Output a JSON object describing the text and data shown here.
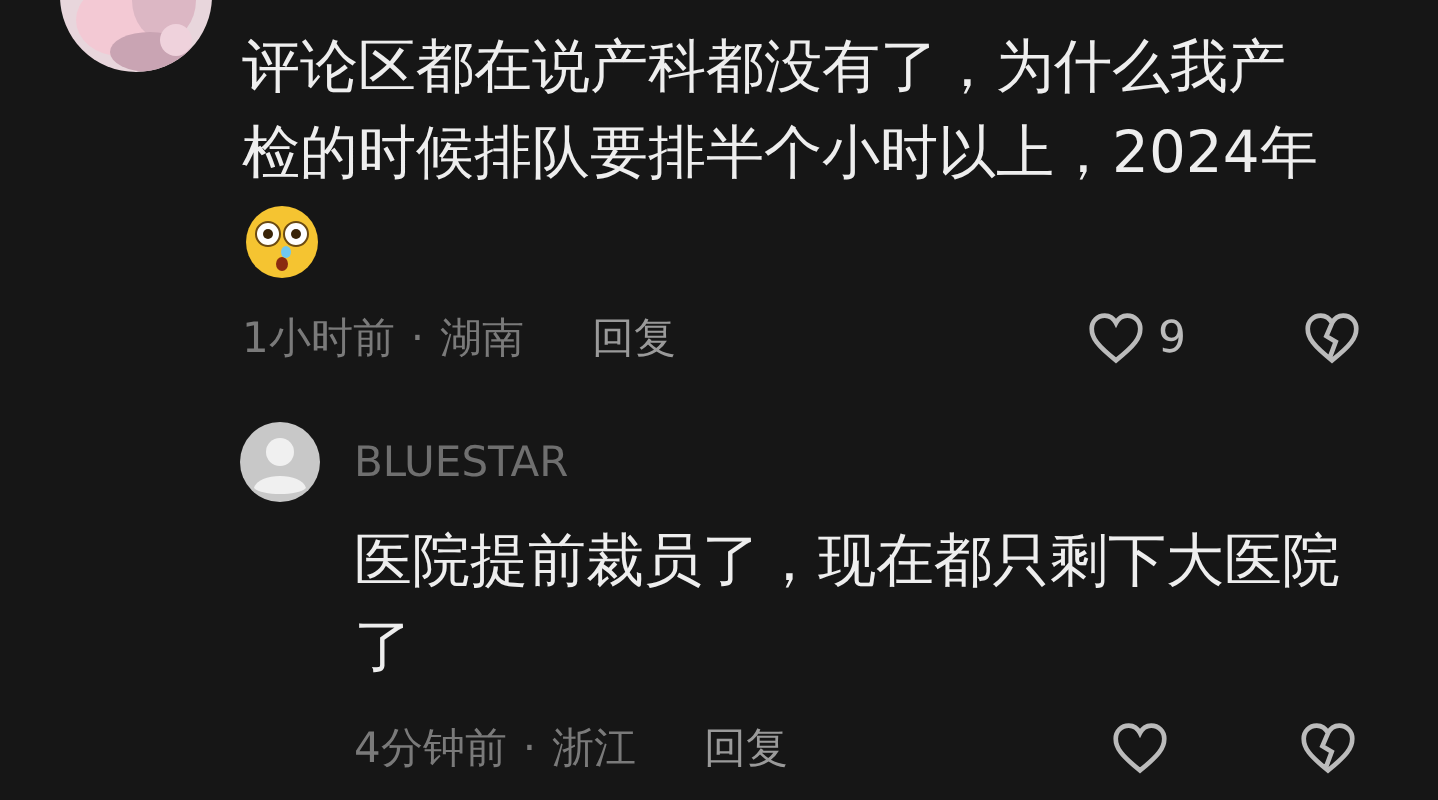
{
  "comment": {
    "text": "评论区都在说产科都没有了，为什么我产检的时候排队要排半个小时以上，2024年",
    "time": "1小时前",
    "separator": "·",
    "location": "湖南",
    "reply_label": "回复",
    "like_count": "9"
  },
  "reply": {
    "username": "BLUESTAR",
    "text": "医院提前裁员了，现在都只剩下大医院了",
    "time": "4分钟前",
    "separator": "·",
    "location": "浙江",
    "reply_label": "回复"
  }
}
